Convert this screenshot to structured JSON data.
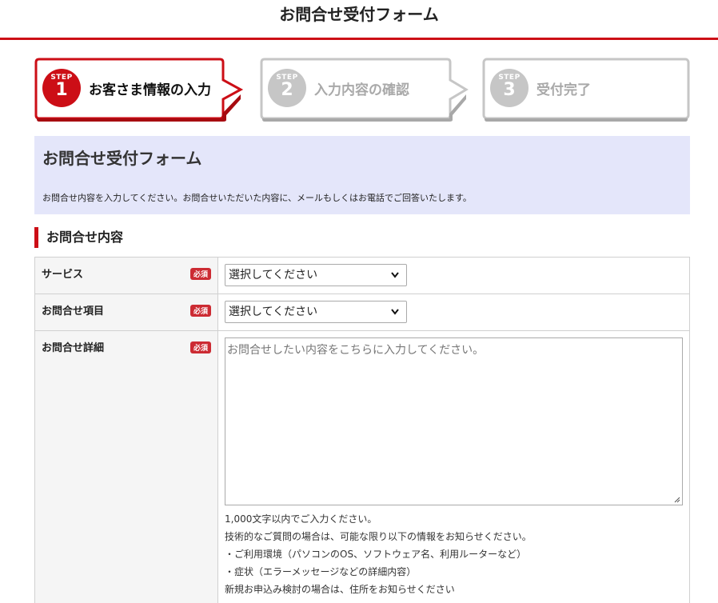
{
  "header": {
    "title": "お問合せ受付フォーム"
  },
  "steps": [
    {
      "word": "STEP",
      "num": "1",
      "label": "お客さま情報の入力",
      "state": "active"
    },
    {
      "word": "STEP",
      "num": "2",
      "label": "入力内容の確認",
      "state": "inactive"
    },
    {
      "word": "STEP",
      "num": "3",
      "label": "受付完了",
      "state": "inactive"
    }
  ],
  "intro": {
    "title": "お問合せ受付フォーム",
    "text": "お問合せ内容を入力してください。お問合せいただいた内容に、メールもしくはお電話でご回答いたします。"
  },
  "section": {
    "title": "お問合せ内容"
  },
  "form": {
    "required_label": "必須",
    "service": {
      "label": "サービス",
      "value": "選択してください"
    },
    "item": {
      "label": "お問合せ項目",
      "value": "選択してください"
    },
    "detail": {
      "label": "お問合せ詳細",
      "placeholder": "お問合せしたい内容をこちらに入力してください。",
      "notes": [
        "1,000文字以内でご入力ください。",
        "技術的なご質問の場合は、可能な限り以下の情報をお知らせください。",
        "・ご利用環境（パソコンのOS、ソフトウェア名、利用ルーターなど）",
        "・症状（エラーメッセージなどの詳細内容）",
        "新規お申込み検討の場合は、住所をお知らせください"
      ]
    }
  },
  "colors": {
    "accent": "#cc0e16",
    "intro_bg": "#e4e6fa",
    "inactive": "#c6c6c6"
  },
  "icons": {
    "select": "chevron-down-icon",
    "resize": "resize-handle-icon"
  }
}
